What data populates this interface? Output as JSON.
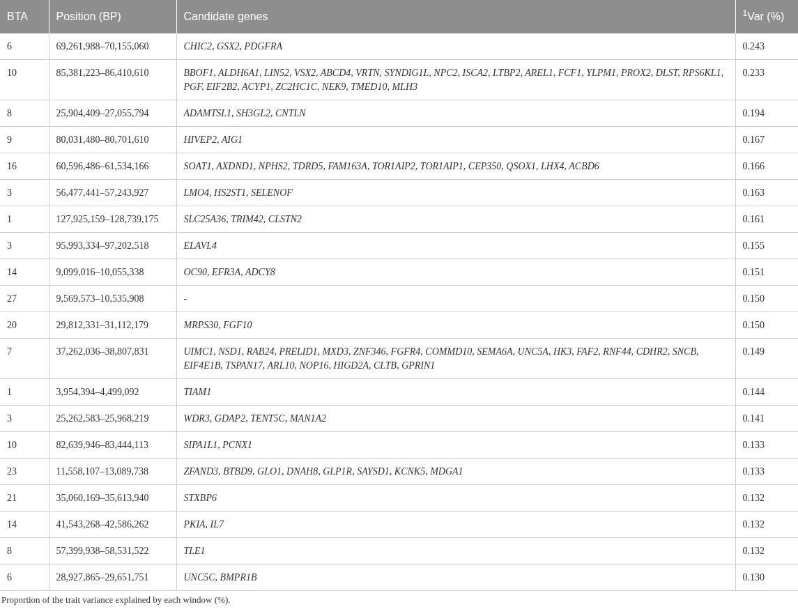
{
  "table": {
    "columns": [
      "BTA",
      "Position (BP)",
      "Candidate genes",
      "$^{1}$Var (%)"
    ],
    "rows": [
      [
        "6",
        "69,261,988–70,155,060",
        "CHIC2, GSX2, PDGFRA",
        "0.243"
      ],
      [
        "10",
        "85,381,223–86,410,610",
        "BBOF1, ALDH6A1, LIN52, VSX2, ABCD4, VRTN, SYNDIG1L, NPC2, ISCA2, LTBP2, AREL1, FCF1, YLPM1, PROX2, DLST, RPS6KL1, PGF, EIF2B2, ACYP1, ZC2HC1C, NEK9, TMED10, MLH3",
        "0.233"
      ],
      [
        "8",
        "25,904,409–27,055,794",
        "ADAMTSL1, SH3GL2, CNTLN",
        "0.194"
      ],
      [
        "9",
        "80,031,480–80,701,610",
        "HIVEP2, AIG1",
        "0.167"
      ],
      [
        "16",
        "60,596,486–61,534,166",
        "SOAT1, AXDND1, NPHS2, TDRD5, FAM163A, TOR1AIP2, TOR1AIP1, CEP350, QSOX1, LHX4, ACBD6",
        "0.166"
      ],
      [
        "3",
        "56,477,441–57,243,927",
        "LMO4, HS2ST1, SELENOF",
        "0.163"
      ],
      [
        "1",
        "127,925,159–128,739,175",
        "SLC25A36, TRIM42, CLSTN2",
        "0.161"
      ],
      [
        "3",
        "95,993,334–97,202,518",
        "ELAVL4",
        "0.155"
      ],
      [
        "14",
        "9,099,016–10,055,338",
        "OC90, EFR3A, ADCY8",
        "0.151"
      ],
      [
        "27",
        "9,569,573–10,535,908",
        "-",
        "0.150"
      ],
      [
        "20",
        "29,812,331–31,112,179",
        "MRPS30, FGF10",
        "0.150"
      ],
      [
        "7",
        "37,262,036–38,807,831",
        "UIMC1, NSD1, RAB24, PRELID1, MXD3, ZNF346, FGFR4, COMMD10, SEMA6A, UNC5A, HK3, FAF2, RNF44, CDHR2, SNCB, EIF4E1B, TSPAN17, ARL10, NOP16, HIGD2A, CLTB, GPRIN1",
        "0.149"
      ],
      [
        "1",
        "3,954,394–4,499,092",
        "TIAM1",
        "0.144"
      ],
      [
        "3",
        "25,262,583–25,968,219",
        "WDR3, GDAP2, TENT5C, MAN1A2",
        "0.141"
      ],
      [
        "10",
        "82,639,946–83,444,113",
        "SIPA1L1, PCNX1",
        "0.133"
      ],
      [
        "23",
        "11,558,107–13,089,738",
        "ZFAND3, BTBD9, GLO1, DNAH8, GLP1R, SAYSD1, KCNK5, MDGA1",
        "0.133"
      ],
      [
        "21",
        "35,060,169–35,613,940",
        "STXBP6",
        "0.132"
      ],
      [
        "14",
        "41,543,268–42,586,262",
        "PKIA, IL7",
        "0.132"
      ],
      [
        "8",
        "57,399,938–58,531,522",
        "TLE1",
        "0.132"
      ],
      [
        "6",
        "28,927,865–29,651,751",
        "UNC5C, BMPR1B",
        "0.130"
      ]
    ]
  },
  "footnote": "Proportion of the trait variance explained by each window (%)."
}
